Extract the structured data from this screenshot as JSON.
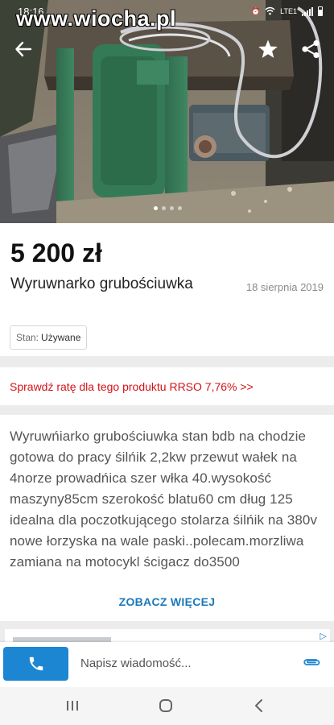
{
  "status_bar": {
    "time": "18:16",
    "network": "LTE1",
    "network_sub": "Vo))"
  },
  "watermark": "www.wiocha.pl",
  "gallery": {
    "slide_index": 1,
    "slide_count": 4
  },
  "listing": {
    "price": "5 200 zł",
    "title": "Wyruwnarko grubościuwka",
    "date": "18 sierpnia 2019",
    "condition_label": "Stan:",
    "condition_value": "Używane"
  },
  "finance_banner": "Sprawdź ratę dla tego produktu RRSO 7,76% >>",
  "description": {
    "text": "Wyruwńiarko grubościuwka stan bdb na chodzie gotowa do pracy śilńik 2,2kw przewut wałek na 4norze prowadńica szer włka 40.wysokość maszyny85cm szerokość blatu60 cm dług 125 idealna dla poczotkującego stolarza śilńik na 380v nowe łorzyska na wale paski..polecam.morzliwa zamiana na motocykl ścigacz do3500",
    "more_label": "ZOBACZ WIĘCEJ"
  },
  "ad": {
    "badge": "▷"
  },
  "contact": {
    "message_placeholder": "Napisz wiadomość..."
  },
  "icons": {
    "back": "arrow-back-icon",
    "favorite": "star-icon",
    "share": "share-icon",
    "call": "phone-icon",
    "attach": "paperclip-icon",
    "recents": "recents-icon",
    "home": "home-icon",
    "nav_back": "chevron-left-icon"
  },
  "colors": {
    "finance_red": "#d41217",
    "link_blue": "#1c78b9",
    "call_button_blue": "#1c86d2"
  }
}
